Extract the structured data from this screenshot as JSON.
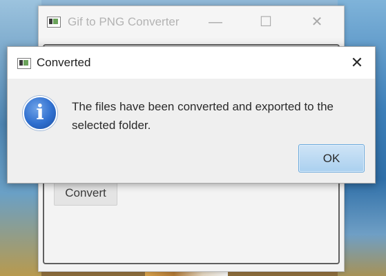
{
  "main_window": {
    "title": "Gif to PNG Converter",
    "minimize_glyph": "—",
    "maximize_glyph": "☐",
    "close_glyph": "✕",
    "convert_label": "Convert"
  },
  "dialog": {
    "title": "Converted",
    "close_glyph": "✕",
    "info_glyph": "i",
    "message": "The files have been converted and exported to the selected folder.",
    "ok_label": "OK"
  },
  "colors": {
    "accent": "#2f6fcf",
    "ok_button": "#aad0ef"
  },
  "icons": [
    "app-icon",
    "info-icon",
    "close-icon",
    "minimize-icon",
    "maximize-icon"
  ]
}
